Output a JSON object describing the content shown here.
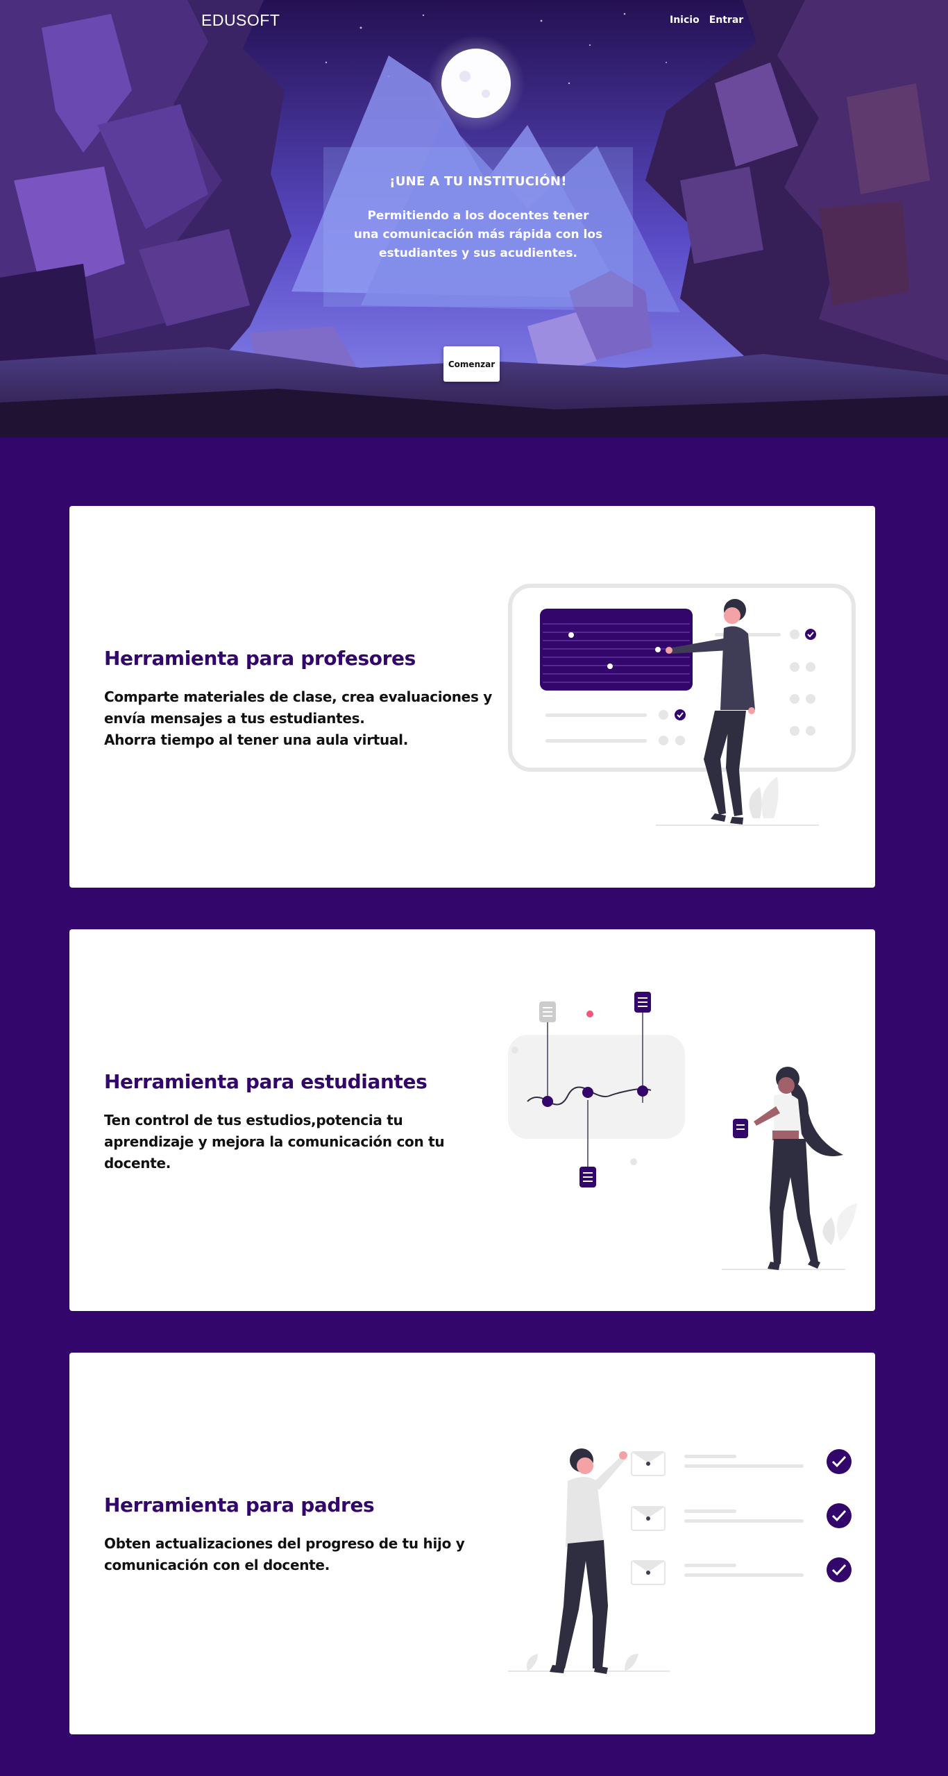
{
  "nav": {
    "brand": "EDUSOFT",
    "links": [
      "Inicio",
      "Entrar"
    ]
  },
  "hero": {
    "heading": "¡UNE A TU INSTITUCIÓN!",
    "subtitle": "Permitiendo a los docentes tener una comunicación más rápida con los estudiantes y sus acudientes.",
    "cta": "Comenzar"
  },
  "features": [
    {
      "title": "Herramienta para profesores",
      "lines": [
        "Comparte materiales de clase, crea evaluaciones y envía mensajes a tus estudiantes.",
        "Ahorra tiempo al tener una aula virtual."
      ],
      "illustration": "teacher-presenting-board-illustration"
    },
    {
      "title": "Herramienta para estudiantes",
      "lines": [
        "Ten control de tus estudios,potencia tu aprendizaje y mejora la comunicación con tu docente."
      ],
      "illustration": "student-progress-chart-illustration"
    },
    {
      "title": "Herramienta para padres",
      "lines": [
        "Obten actualizaciones del progreso de tu hijo y comunicación con el docente."
      ],
      "illustration": "parent-checklist-illustration"
    }
  ],
  "colors": {
    "primary": "#33066b",
    "accent": "#f3567c",
    "card_background": "#ffffff",
    "text": "#111111"
  }
}
